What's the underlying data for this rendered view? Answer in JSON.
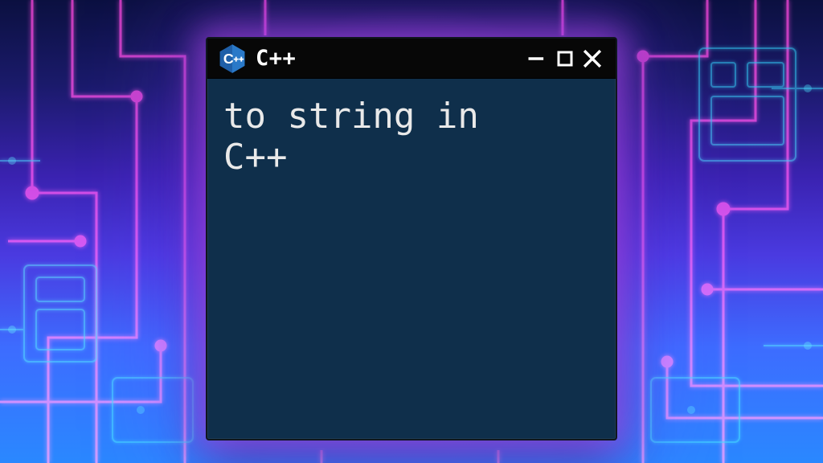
{
  "window": {
    "title": "C++",
    "body_text": "to string in\nC++"
  },
  "icons": {
    "logo": "cpp-hex-icon",
    "minimize": "minimize-icon",
    "maximize": "maximize-icon",
    "close": "close-icon"
  }
}
